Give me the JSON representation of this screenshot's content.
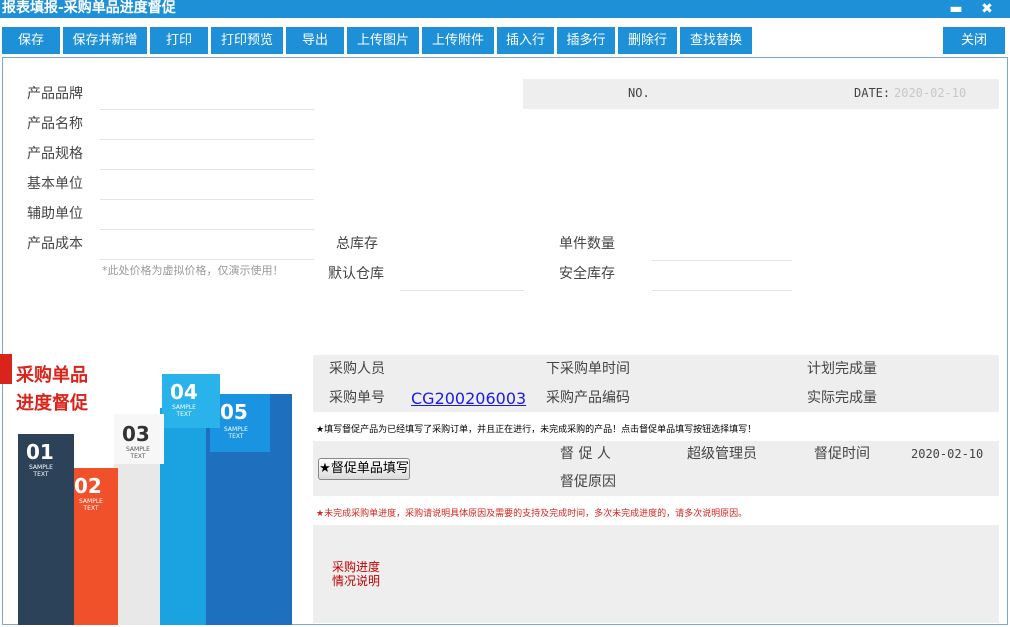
{
  "window": {
    "title": "报表填报-采购单品进度督促",
    "minimize_glyph": "▬",
    "close_glyph": "✖"
  },
  "toolbar": {
    "buttons": [
      {
        "label": "保存"
      },
      {
        "label": "保存并新增"
      },
      {
        "label": "打印"
      },
      {
        "label": "打印预览"
      },
      {
        "label": "导出"
      },
      {
        "label": "上传图片"
      },
      {
        "label": "上传附件"
      },
      {
        "label": "插入行"
      },
      {
        "label": "插多行"
      },
      {
        "label": "删除行"
      },
      {
        "label": "查找替换"
      }
    ],
    "close_label": "关闭"
  },
  "form": {
    "brand_label": "产品品牌",
    "name_label": "产品名称",
    "spec_label": "产品规格",
    "base_unit_label": "基本单位",
    "aux_unit_label": "辅助单位",
    "cost_label": "产品成本",
    "cost_note": "*此处价格为虚拟价格，仅演示使用！",
    "total_stock_label": "总库存",
    "default_warehouse_label": "默认仓库",
    "unit_qty_label": "单件数量",
    "safety_stock_label": "安全库存",
    "no_label": "NO.",
    "date_label": "DATE:",
    "date_value": "2020-02-10"
  },
  "section": {
    "title_line1": "采购单品",
    "title_line2": "进度督促"
  },
  "infographic": {
    "boxes": [
      {
        "num": "01",
        "caption": "SAMPLE TEXT",
        "color": "#2b4258"
      },
      {
        "num": "02",
        "caption": "SAMPLE TEXT",
        "color": "#f0502a"
      },
      {
        "num": "03",
        "caption": "SAMPLE TEXT",
        "color": "#e8e8e8"
      },
      {
        "num": "04",
        "caption": "SAMPLE TEXT",
        "color": "#1aa3e0"
      },
      {
        "num": "05",
        "caption": "SAMPLE TEXT",
        "color": "#1f6fbf"
      }
    ]
  },
  "purchase": {
    "buyer_label": "采购人员",
    "order_time_label": "下采购单时间",
    "plan_qty_label": "计划完成量",
    "order_no_label": "采购单号",
    "order_no_value": "CG200206003",
    "product_code_label": "采购产品编码",
    "actual_qty_label": "实际完成量",
    "note1": "★填写督促产品为已经填写了采购订单，并且正在进行，未完成采购的产品！点击督促单品填写按钮选择填写！"
  },
  "urge": {
    "button_label": "★督促单品填写",
    "urger_label": "督 促 人",
    "urger_value": "超级管理员",
    "time_label": "督促时间",
    "time_value": "2020-02-10",
    "reason_label": "督促原因",
    "note2": "★未完成采购单进度，采购请说明具体原因及需要的支持及完成时间，多次未完成进度的，请多次说明原因。"
  },
  "progress": {
    "label_line1": "采购进度",
    "label_line2": "情况说明"
  },
  "colors": {
    "accent": "#1e90d8",
    "title_red": "#d9241c",
    "panel_gray": "#eeeeee",
    "link_blue": "#1a1ae6"
  }
}
